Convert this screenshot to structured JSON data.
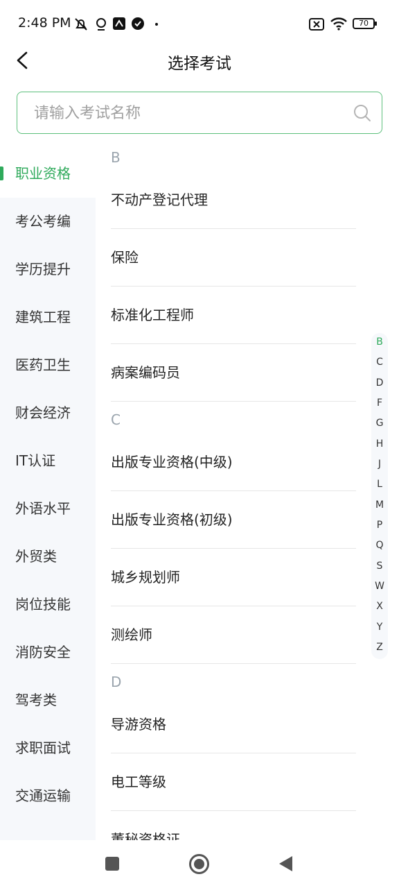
{
  "status_bar": {
    "time": "2:48 PM",
    "battery": "70"
  },
  "header": {
    "title": "选择考试"
  },
  "search": {
    "placeholder": "请输入考试名称"
  },
  "sidebar": {
    "items": [
      {
        "label": "职业资格",
        "active": true
      },
      {
        "label": "考公考编"
      },
      {
        "label": "学历提升"
      },
      {
        "label": "建筑工程"
      },
      {
        "label": "医药卫生"
      },
      {
        "label": "财会经济"
      },
      {
        "label": "IT认证"
      },
      {
        "label": "外语水平"
      },
      {
        "label": "外贸类"
      },
      {
        "label": "岗位技能"
      },
      {
        "label": "消防安全"
      },
      {
        "label": "驾考类"
      },
      {
        "label": "求职面试"
      },
      {
        "label": "交通运输"
      }
    ]
  },
  "list": {
    "sections": [
      {
        "letter": "B",
        "items": [
          "不动产登记代理",
          "保险",
          "标准化工程师",
          "病案编码员"
        ]
      },
      {
        "letter": "C",
        "items": [
          "出版专业资格(中级)",
          "出版专业资格(初级)",
          "城乡规划师",
          "测绘师"
        ]
      },
      {
        "letter": "D",
        "items": [
          "导游资格",
          "电工等级",
          "董秘资格证"
        ]
      }
    ]
  },
  "index": {
    "letters": [
      "B",
      "C",
      "D",
      "F",
      "G",
      "H",
      "J",
      "L",
      "M",
      "P",
      "Q",
      "S",
      "W",
      "X",
      "Y",
      "Z"
    ],
    "active": "B"
  },
  "colors": {
    "accent": "#2faa5b",
    "search_border": "#5bbf7a",
    "sidebar_bg": "#f6f8fb"
  }
}
